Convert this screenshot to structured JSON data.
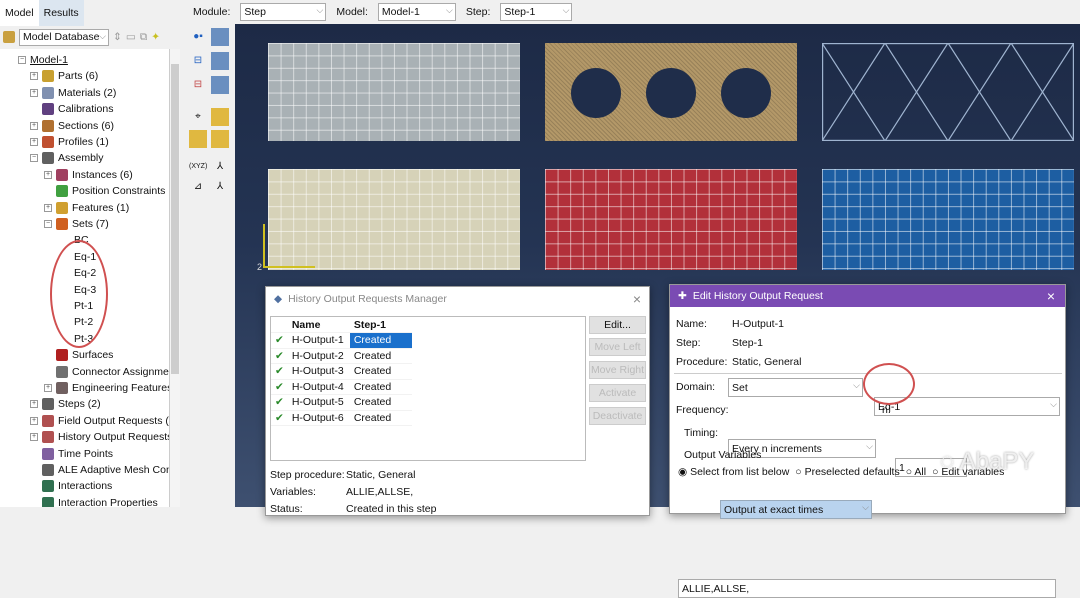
{
  "tabs": [
    {
      "label": "Model"
    },
    {
      "label": "Results"
    }
  ],
  "db_select": "Model Database",
  "context": {
    "module_label": "Module:",
    "module": "Step",
    "model_label": "Model:",
    "model": "Model-1",
    "step_label": "Step:",
    "step": "Step-1"
  },
  "tree": [
    {
      "label": "Model-1",
      "level": 0,
      "pm": "−"
    },
    {
      "label": "Parts (6)",
      "level": 1,
      "pm": "+",
      "color": "#c8a030"
    },
    {
      "label": "Materials (2)",
      "level": 1,
      "pm": "+",
      "color": "#8090b0"
    },
    {
      "label": "Calibrations",
      "level": 1,
      "pm": "",
      "color": "#604080"
    },
    {
      "label": "Sections (6)",
      "level": 1,
      "pm": "+",
      "color": "#b07030"
    },
    {
      "label": "Profiles (1)",
      "level": 1,
      "pm": "+",
      "color": "#c05030"
    },
    {
      "label": "Assembly",
      "level": 1,
      "pm": "−",
      "color": "#606060"
    },
    {
      "label": "Instances (6)",
      "level": 2,
      "pm": "+",
      "color": "#a04060"
    },
    {
      "label": "Position Constraints",
      "level": 2,
      "pm": "",
      "color": "#40a040"
    },
    {
      "label": "Features (1)",
      "level": 2,
      "pm": "+",
      "color": "#d0a030"
    },
    {
      "label": "Sets (7)",
      "level": 2,
      "pm": "−",
      "color": "#d06020"
    },
    {
      "label": "BC",
      "level": 3,
      "pm": ""
    },
    {
      "label": "Eq-1",
      "level": 3,
      "pm": ""
    },
    {
      "label": "Eq-2",
      "level": 3,
      "pm": ""
    },
    {
      "label": "Eq-3",
      "level": 3,
      "pm": ""
    },
    {
      "label": "Pt-1",
      "level": 3,
      "pm": ""
    },
    {
      "label": "Pt-2",
      "level": 3,
      "pm": ""
    },
    {
      "label": "Pt-3",
      "level": 3,
      "pm": ""
    },
    {
      "label": "Surfaces",
      "level": 2,
      "pm": "",
      "color": "#b02020"
    },
    {
      "label": "Connector Assignmer",
      "level": 2,
      "pm": "",
      "color": "#707070"
    },
    {
      "label": "Engineering Features",
      "level": 2,
      "pm": "+",
      "color": "#706060"
    },
    {
      "label": "Steps (2)",
      "level": 1,
      "pm": "+",
      "color": "#606060"
    },
    {
      "label": "Field Output Requests (1",
      "level": 1,
      "pm": "+",
      "color": "#b05050"
    },
    {
      "label": "History Output Requests",
      "level": 1,
      "pm": "+",
      "color": "#b05050"
    },
    {
      "label": "Time Points",
      "level": 1,
      "pm": "",
      "color": "#8060a0"
    },
    {
      "label": "ALE Adaptive Mesh Cons",
      "level": 1,
      "pm": "",
      "color": "#606060"
    },
    {
      "label": "Interactions",
      "level": 1,
      "pm": "",
      "color": "#307050"
    },
    {
      "label": "Interaction Properties",
      "level": 1,
      "pm": "",
      "color": "#307050"
    }
  ],
  "viewport": {
    "background": "#1d2a46",
    "mesh_colors": [
      "#a9b1b5",
      "#b39868",
      "#1d2a46",
      "#d6d2b8",
      "#b2303a",
      "#1d5ea2"
    ],
    "triad": {
      "x": "1",
      "y": "2"
    }
  },
  "manager": {
    "title": "History Output Requests Manager",
    "columns": [
      "Name",
      "Step-1"
    ],
    "rows": [
      {
        "name": "H-Output-1",
        "status": "Created"
      },
      {
        "name": "H-Output-2",
        "status": "Created"
      },
      {
        "name": "H-Output-3",
        "status": "Created"
      },
      {
        "name": "H-Output-4",
        "status": "Created"
      },
      {
        "name": "H-Output-5",
        "status": "Created"
      },
      {
        "name": "H-Output-6",
        "status": "Created"
      }
    ],
    "buttons": {
      "edit": "Edit...",
      "move_left": "Move Left",
      "move_right": "Move Right",
      "activate": "Activate",
      "deactivate": "Deactivate"
    },
    "info": {
      "procedure_label": "Step procedure:",
      "procedure": "Static, General",
      "variables_label": "Variables:",
      "variables": "ALLIE,ALLSE,",
      "status_label": "Status:",
      "status": "Created in this step"
    }
  },
  "editor": {
    "title": "Edit History Output Request",
    "title_color": "#7a4bb3",
    "name_label": "Name:",
    "name": "H-Output-1",
    "step_label": "Step:",
    "step": "Step-1",
    "procedure_label": "Procedure:",
    "procedure": "Static, General",
    "domain_label": "Domain:",
    "domain": "Set",
    "domain_set": "Eq-1",
    "frequency_label": "Frequency:",
    "frequency": "Every n increments",
    "n_label": "n:",
    "n": "1",
    "timing_label": "Timing:",
    "timing": "Output at exact times",
    "output_vars_label": "Output Variables",
    "radios": [
      {
        "label": "Select from list below",
        "checked": true
      },
      {
        "label": "Preselected defaults",
        "checked": false
      },
      {
        "label": "All",
        "checked": false
      },
      {
        "label": "Edit variables",
        "checked": false
      }
    ],
    "vars_value": "ALLIE,ALLSE,"
  },
  "watermark": "AbaPY"
}
